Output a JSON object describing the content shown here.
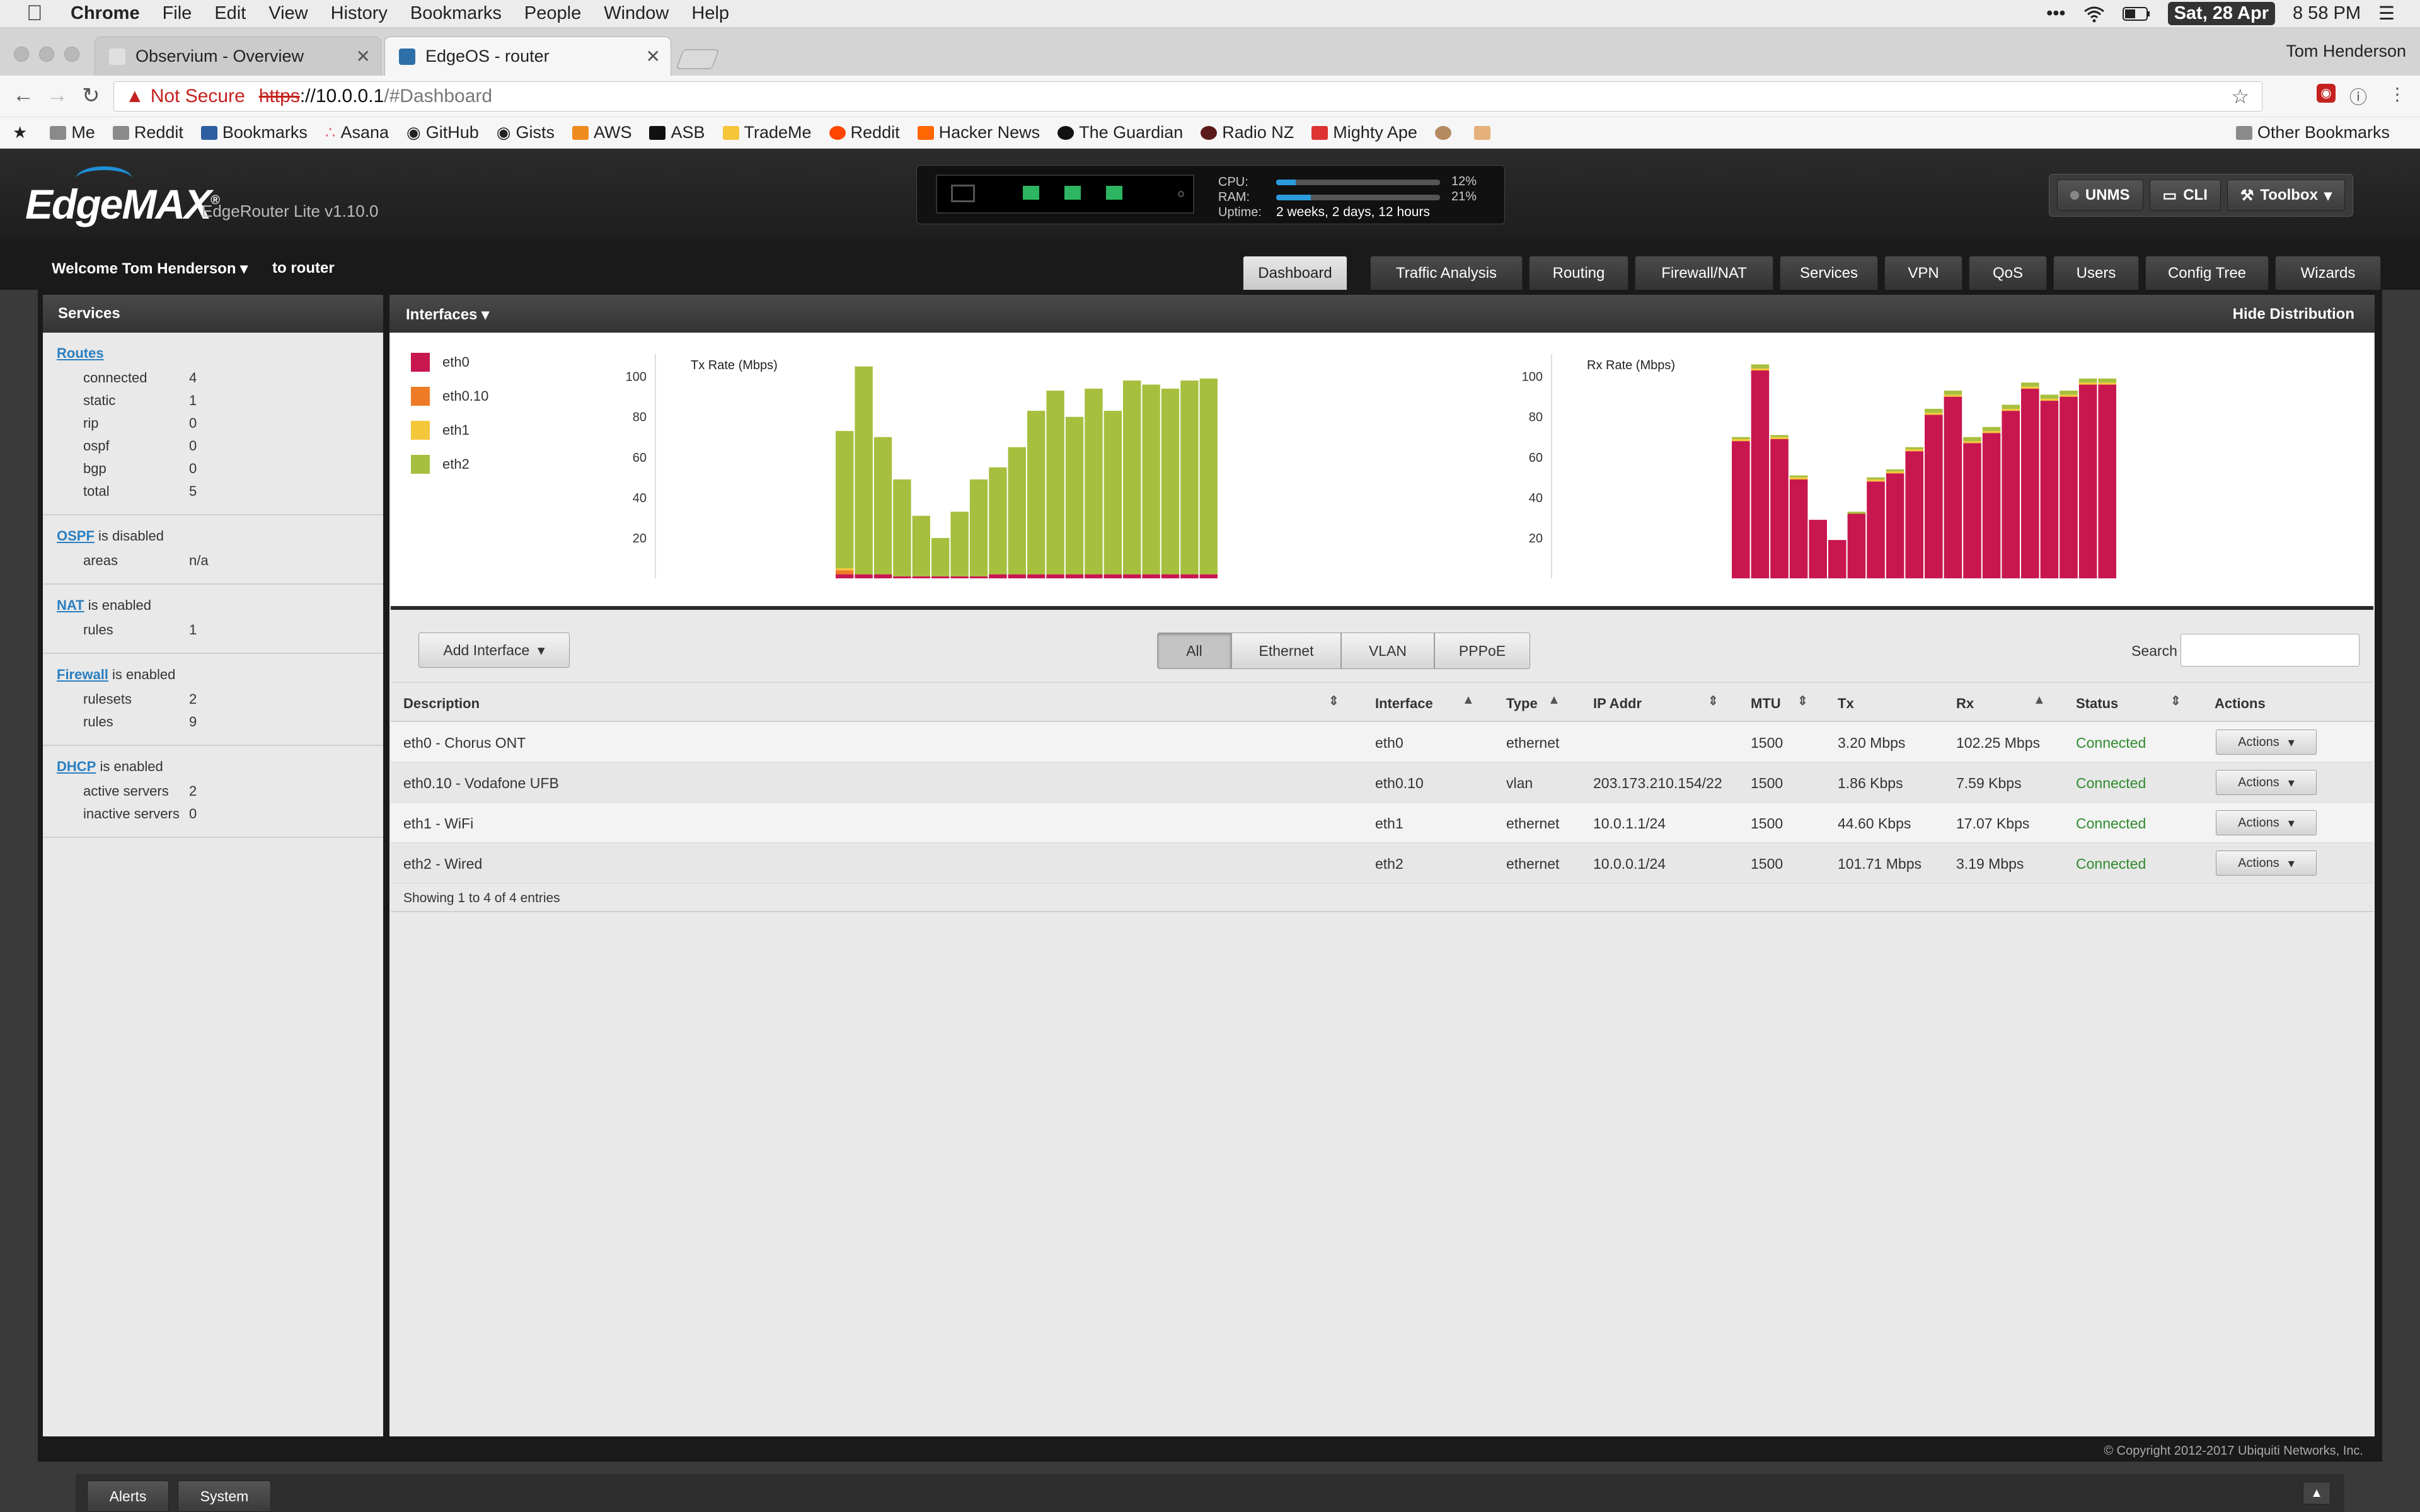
{
  "menubar": {
    "app": "Chrome",
    "items": [
      "File",
      "Edit",
      "View",
      "History",
      "Bookmarks",
      "People",
      "Window",
      "Help"
    ],
    "date": "Sat, 28 Apr",
    "time": "8 58 PM"
  },
  "browser": {
    "tabs": [
      {
        "title": "Observium - Overview",
        "active": false
      },
      {
        "title": "EdgeOS - router",
        "active": true
      }
    ],
    "profile": "Tom Henderson",
    "security_label": "Not Secure",
    "url_scheme": "https",
    "url_host": "://10.0.0.1",
    "url_path": "/#Dashboard",
    "bookmarks": [
      "Me",
      "Reddit",
      "Bookmarks",
      "Asana",
      "GitHub",
      "Gists",
      "AWS",
      "ASB",
      "TradeMe",
      "Reddit",
      "Hacker News",
      "The Guardian",
      "Radio NZ",
      "Mighty Ape"
    ],
    "other_bookmarks": "Other Bookmarks"
  },
  "header": {
    "logo": "EdgeMAX",
    "model": "EdgeRouter Lite v1.10.0",
    "cpu_label": "CPU:",
    "cpu_value": "12%",
    "cpu_fraction": 0.12,
    "ram_label": "RAM:",
    "ram_value": "21%",
    "ram_fraction": 0.21,
    "uptime_label": "Uptime:",
    "uptime_value": "2 weeks, 2 days, 12 hours",
    "unms": "UNMS",
    "cli": "CLI",
    "toolbox": "Toolbox"
  },
  "nav": {
    "welcome": "Welcome Tom Henderson",
    "to_router": "to router",
    "tabs": [
      "Dashboard",
      "Traffic Analysis",
      "Routing",
      "Firewall/NAT",
      "Services",
      "VPN",
      "QoS",
      "Users",
      "Config Tree",
      "Wizards"
    ]
  },
  "sidebar": {
    "title": "Services",
    "routes": {
      "link": "Routes",
      "rows": [
        {
          "k": "connected",
          "v": "4"
        },
        {
          "k": "static",
          "v": "1"
        },
        {
          "k": "rip",
          "v": "0"
        },
        {
          "k": "ospf",
          "v": "0"
        },
        {
          "k": "bgp",
          "v": "0"
        },
        {
          "k": "total",
          "v": "5"
        }
      ]
    },
    "ospf": {
      "link": "OSPF",
      "state": " is disabled",
      "rows": [
        {
          "k": "areas",
          "v": "n/a"
        }
      ]
    },
    "nat": {
      "link": "NAT",
      "state": " is enabled",
      "rows": [
        {
          "k": "rules",
          "v": "1"
        }
      ]
    },
    "firewall": {
      "link": "Firewall",
      "state": " is enabled",
      "rows": [
        {
          "k": "rulesets",
          "v": "2"
        },
        {
          "k": "rules",
          "v": "9"
        }
      ]
    },
    "dhcp": {
      "link": "DHCP",
      "state": " is enabled",
      "rows": [
        {
          "k": "active servers",
          "v": "2"
        },
        {
          "k": "inactive servers",
          "v": "0"
        }
      ]
    }
  },
  "interfaces_panel": {
    "title": "Interfaces",
    "hide_distribution": "Hide Distribution"
  },
  "chart_data": [
    {
      "type": "bar",
      "title": "Tx Rate (Mbps)",
      "ylabel": "",
      "y_ticks": [
        20,
        40,
        60,
        80,
        100
      ],
      "ylim": [
        0,
        108
      ],
      "stacked": true,
      "legend": "left",
      "series": [
        {
          "name": "eth0",
          "color": "#c8174f",
          "values": [
            2,
            2,
            2,
            1,
            1,
            1,
            1,
            1,
            2,
            2,
            2,
            2,
            2,
            2,
            2,
            2,
            2,
            2,
            2,
            2
          ]
        },
        {
          "name": "eth0.10",
          "color": "#ee7b25",
          "values": [
            2,
            0,
            0,
            0,
            0,
            0,
            0,
            0,
            0,
            0,
            0,
            0,
            0,
            0,
            0,
            0,
            0,
            0,
            0,
            0
          ]
        },
        {
          "name": "eth1",
          "color": "#f5c73b",
          "values": [
            1,
            0,
            0,
            0,
            0,
            0,
            0,
            0,
            0,
            0,
            0,
            0,
            0,
            0,
            0,
            0,
            0,
            0,
            0,
            0
          ]
        },
        {
          "name": "eth2",
          "color": "#a7bf3e",
          "values": [
            68,
            103,
            68,
            48,
            30,
            19,
            32,
            48,
            53,
            63,
            81,
            91,
            78,
            92,
            81,
            96,
            94,
            92,
            96,
            97
          ]
        }
      ]
    },
    {
      "type": "bar",
      "title": "Rx Rate (Mbps)",
      "ylabel": "",
      "y_ticks": [
        20,
        40,
        60,
        80,
        100
      ],
      "ylim": [
        0,
        108
      ],
      "stacked": true,
      "series": [
        {
          "name": "eth0",
          "color": "#c8174f",
          "values": [
            68,
            103,
            69,
            49,
            29,
            19,
            32,
            48,
            52,
            63,
            81,
            90,
            67,
            72,
            83,
            94,
            88,
            90,
            96,
            96
          ]
        },
        {
          "name": "eth0.10",
          "color": "#ee7b25",
          "values": [
            0,
            0,
            0,
            0,
            0,
            0,
            0,
            0,
            0,
            0,
            0,
            0,
            0,
            0,
            0,
            0,
            0,
            0,
            0,
            0
          ]
        },
        {
          "name": "eth1",
          "color": "#f5c73b",
          "values": [
            1,
            1,
            1,
            1,
            0,
            0,
            0,
            1,
            1,
            1,
            1,
            1,
            1,
            1,
            1,
            1,
            1,
            1,
            1,
            1
          ]
        },
        {
          "name": "eth2",
          "color": "#a7bf3e",
          "values": [
            1,
            2,
            1,
            1,
            0,
            0,
            1,
            1,
            1,
            1,
            2,
            2,
            2,
            2,
            2,
            2,
            2,
            2,
            2,
            2
          ]
        }
      ]
    }
  ],
  "toolbar": {
    "add_interface": "Add Interface",
    "filters": [
      "All",
      "Ethernet",
      "VLAN",
      "PPPoE"
    ],
    "active_filter": "All",
    "search_label": "Search",
    "search_value": ""
  },
  "table": {
    "headers": [
      "Description",
      "Interface",
      "Type",
      "IP Addr",
      "MTU",
      "Tx",
      "Rx",
      "Status",
      "Actions"
    ],
    "rows": [
      {
        "description": "eth0 - Chorus ONT",
        "interface": "eth0",
        "type": "ethernet",
        "ip": "",
        "mtu": "1500",
        "tx": "3.20 Mbps",
        "rx": "102.25 Mbps",
        "status": "Connected",
        "action": "Actions"
      },
      {
        "description": "eth0.10 - Vodafone UFB",
        "interface": "eth0.10",
        "type": "vlan",
        "ip": "203.173.210.154/22",
        "mtu": "1500",
        "tx": "1.86 Kbps",
        "rx": "7.59 Kbps",
        "status": "Connected",
        "action": "Actions"
      },
      {
        "description": "eth1 - WiFi",
        "interface": "eth1",
        "type": "ethernet",
        "ip": "10.0.1.1/24",
        "mtu": "1500",
        "tx": "44.60 Kbps",
        "rx": "17.07 Kbps",
        "status": "Connected",
        "action": "Actions"
      },
      {
        "description": "eth2 - Wired",
        "interface": "eth2",
        "type": "ethernet",
        "ip": "10.0.0.1/24",
        "mtu": "1500",
        "tx": "101.71 Mbps",
        "rx": "3.19 Mbps",
        "status": "Connected",
        "action": "Actions"
      }
    ],
    "showing": "Showing 1 to 4 of 4 entries"
  },
  "footer": {
    "copyright": "© Copyright 2012-2017 Ubiquiti Networks, Inc.",
    "tabs": [
      "Alerts",
      "System"
    ]
  }
}
